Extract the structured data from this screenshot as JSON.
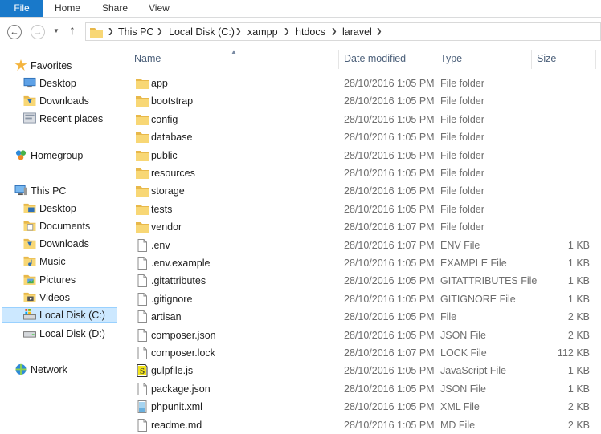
{
  "ribbon": {
    "tabs": [
      "File",
      "Home",
      "Share",
      "View"
    ]
  },
  "address": {
    "crumbs": [
      "This PC",
      "Local Disk (C:)",
      "xampp",
      "htdocs",
      "laravel"
    ]
  },
  "nav": {
    "items": [
      {
        "label": "Favorites",
        "icon": "star-icon",
        "indent": 0
      },
      {
        "label": "Desktop",
        "icon": "desktop-icon",
        "indent": 1
      },
      {
        "label": "Downloads",
        "icon": "downloads-icon",
        "indent": 1
      },
      {
        "label": "Recent places",
        "icon": "recent-places-icon",
        "indent": 1
      },
      {
        "label": "Homegroup",
        "icon": "homegroup-icon",
        "indent": 0
      },
      {
        "label": "This PC",
        "icon": "computer-icon",
        "indent": 0
      },
      {
        "label": "Desktop",
        "icon": "desktop-folder-icon",
        "indent": 1
      },
      {
        "label": "Documents",
        "icon": "documents-icon",
        "indent": 1
      },
      {
        "label": "Downloads",
        "icon": "downloads-icon",
        "indent": 1
      },
      {
        "label": "Music",
        "icon": "music-icon",
        "indent": 1
      },
      {
        "label": "Pictures",
        "icon": "pictures-icon",
        "indent": 1
      },
      {
        "label": "Videos",
        "icon": "videos-icon",
        "indent": 1
      },
      {
        "label": "Local Disk (C:)",
        "icon": "system-drive-icon",
        "indent": 1,
        "selected": true
      },
      {
        "label": "Local Disk (D:)",
        "icon": "drive-icon",
        "indent": 1
      },
      {
        "label": "Network",
        "icon": "network-icon",
        "indent": 0
      }
    ]
  },
  "columns": {
    "name": "Name",
    "date": "Date modified",
    "type": "Type",
    "size": "Size"
  },
  "files": [
    {
      "name": "app",
      "date": "28/10/2016 1:05 PM",
      "type": "File folder",
      "size": "",
      "icon": "folder-icon"
    },
    {
      "name": "bootstrap",
      "date": "28/10/2016 1:05 PM",
      "type": "File folder",
      "size": "",
      "icon": "folder-icon"
    },
    {
      "name": "config",
      "date": "28/10/2016 1:05 PM",
      "type": "File folder",
      "size": "",
      "icon": "folder-icon"
    },
    {
      "name": "database",
      "date": "28/10/2016 1:05 PM",
      "type": "File folder",
      "size": "",
      "icon": "folder-icon"
    },
    {
      "name": "public",
      "date": "28/10/2016 1:05 PM",
      "type": "File folder",
      "size": "",
      "icon": "folder-icon"
    },
    {
      "name": "resources",
      "date": "28/10/2016 1:05 PM",
      "type": "File folder",
      "size": "",
      "icon": "folder-icon"
    },
    {
      "name": "storage",
      "date": "28/10/2016 1:05 PM",
      "type": "File folder",
      "size": "",
      "icon": "folder-icon"
    },
    {
      "name": "tests",
      "date": "28/10/2016 1:05 PM",
      "type": "File folder",
      "size": "",
      "icon": "folder-icon"
    },
    {
      "name": "vendor",
      "date": "28/10/2016 1:07 PM",
      "type": "File folder",
      "size": "",
      "icon": "folder-icon"
    },
    {
      "name": ".env",
      "date": "28/10/2016 1:07 PM",
      "type": "ENV File",
      "size": "1 KB",
      "icon": "file-icon"
    },
    {
      "name": ".env.example",
      "date": "28/10/2016 1:05 PM",
      "type": "EXAMPLE File",
      "size": "1 KB",
      "icon": "file-icon"
    },
    {
      "name": ".gitattributes",
      "date": "28/10/2016 1:05 PM",
      "type": "GITATTRIBUTES File",
      "size": "1 KB",
      "icon": "file-icon"
    },
    {
      "name": ".gitignore",
      "date": "28/10/2016 1:05 PM",
      "type": "GITIGNORE File",
      "size": "1 KB",
      "icon": "file-icon"
    },
    {
      "name": "artisan",
      "date": "28/10/2016 1:05 PM",
      "type": "File",
      "size": "2 KB",
      "icon": "file-icon"
    },
    {
      "name": "composer.json",
      "date": "28/10/2016 1:05 PM",
      "type": "JSON File",
      "size": "2 KB",
      "icon": "file-icon"
    },
    {
      "name": "composer.lock",
      "date": "28/10/2016 1:07 PM",
      "type": "LOCK File",
      "size": "112 KB",
      "icon": "file-icon"
    },
    {
      "name": "gulpfile.js",
      "date": "28/10/2016 1:05 PM",
      "type": "JavaScript File",
      "size": "1 KB",
      "icon": "javascript-file-icon"
    },
    {
      "name": "package.json",
      "date": "28/10/2016 1:05 PM",
      "type": "JSON File",
      "size": "1 KB",
      "icon": "file-icon"
    },
    {
      "name": "phpunit.xml",
      "date": "28/10/2016 1:05 PM",
      "type": "XML File",
      "size": "2 KB",
      "icon": "xml-file-icon"
    },
    {
      "name": "readme.md",
      "date": "28/10/2016 1:05 PM",
      "type": "MD File",
      "size": "2 KB",
      "icon": "file-icon"
    }
  ],
  "colors": {
    "accent": "#1979ca",
    "selection": "#cce8ff",
    "header_text": "#4c607a",
    "folder": "#f8d775"
  }
}
